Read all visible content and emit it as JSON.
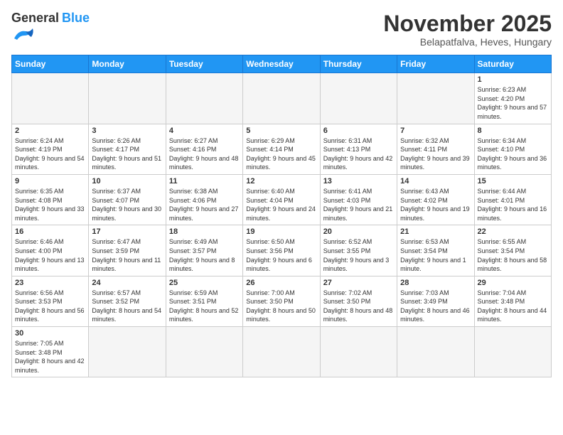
{
  "logo": {
    "general": "General",
    "blue": "Blue"
  },
  "header": {
    "title": "November 2025",
    "location": "Belapatfalva, Heves, Hungary"
  },
  "weekdays": [
    "Sunday",
    "Monday",
    "Tuesday",
    "Wednesday",
    "Thursday",
    "Friday",
    "Saturday"
  ],
  "weeks": [
    [
      {
        "day": "",
        "info": ""
      },
      {
        "day": "",
        "info": ""
      },
      {
        "day": "",
        "info": ""
      },
      {
        "day": "",
        "info": ""
      },
      {
        "day": "",
        "info": ""
      },
      {
        "day": "",
        "info": ""
      },
      {
        "day": "1",
        "info": "Sunrise: 6:23 AM\nSunset: 4:20 PM\nDaylight: 9 hours and 57 minutes."
      }
    ],
    [
      {
        "day": "2",
        "info": "Sunrise: 6:24 AM\nSunset: 4:19 PM\nDaylight: 9 hours and 54 minutes."
      },
      {
        "day": "3",
        "info": "Sunrise: 6:26 AM\nSunset: 4:17 PM\nDaylight: 9 hours and 51 minutes."
      },
      {
        "day": "4",
        "info": "Sunrise: 6:27 AM\nSunset: 4:16 PM\nDaylight: 9 hours and 48 minutes."
      },
      {
        "day": "5",
        "info": "Sunrise: 6:29 AM\nSunset: 4:14 PM\nDaylight: 9 hours and 45 minutes."
      },
      {
        "day": "6",
        "info": "Sunrise: 6:31 AM\nSunset: 4:13 PM\nDaylight: 9 hours and 42 minutes."
      },
      {
        "day": "7",
        "info": "Sunrise: 6:32 AM\nSunset: 4:11 PM\nDaylight: 9 hours and 39 minutes."
      },
      {
        "day": "8",
        "info": "Sunrise: 6:34 AM\nSunset: 4:10 PM\nDaylight: 9 hours and 36 minutes."
      }
    ],
    [
      {
        "day": "9",
        "info": "Sunrise: 6:35 AM\nSunset: 4:08 PM\nDaylight: 9 hours and 33 minutes."
      },
      {
        "day": "10",
        "info": "Sunrise: 6:37 AM\nSunset: 4:07 PM\nDaylight: 9 hours and 30 minutes."
      },
      {
        "day": "11",
        "info": "Sunrise: 6:38 AM\nSunset: 4:06 PM\nDaylight: 9 hours and 27 minutes."
      },
      {
        "day": "12",
        "info": "Sunrise: 6:40 AM\nSunset: 4:04 PM\nDaylight: 9 hours and 24 minutes."
      },
      {
        "day": "13",
        "info": "Sunrise: 6:41 AM\nSunset: 4:03 PM\nDaylight: 9 hours and 21 minutes."
      },
      {
        "day": "14",
        "info": "Sunrise: 6:43 AM\nSunset: 4:02 PM\nDaylight: 9 hours and 19 minutes."
      },
      {
        "day": "15",
        "info": "Sunrise: 6:44 AM\nSunset: 4:01 PM\nDaylight: 9 hours and 16 minutes."
      }
    ],
    [
      {
        "day": "16",
        "info": "Sunrise: 6:46 AM\nSunset: 4:00 PM\nDaylight: 9 hours and 13 minutes."
      },
      {
        "day": "17",
        "info": "Sunrise: 6:47 AM\nSunset: 3:59 PM\nDaylight: 9 hours and 11 minutes."
      },
      {
        "day": "18",
        "info": "Sunrise: 6:49 AM\nSunset: 3:57 PM\nDaylight: 9 hours and 8 minutes."
      },
      {
        "day": "19",
        "info": "Sunrise: 6:50 AM\nSunset: 3:56 PM\nDaylight: 9 hours and 6 minutes."
      },
      {
        "day": "20",
        "info": "Sunrise: 6:52 AM\nSunset: 3:55 PM\nDaylight: 9 hours and 3 minutes."
      },
      {
        "day": "21",
        "info": "Sunrise: 6:53 AM\nSunset: 3:54 PM\nDaylight: 9 hours and 1 minute."
      },
      {
        "day": "22",
        "info": "Sunrise: 6:55 AM\nSunset: 3:54 PM\nDaylight: 8 hours and 58 minutes."
      }
    ],
    [
      {
        "day": "23",
        "info": "Sunrise: 6:56 AM\nSunset: 3:53 PM\nDaylight: 8 hours and 56 minutes."
      },
      {
        "day": "24",
        "info": "Sunrise: 6:57 AM\nSunset: 3:52 PM\nDaylight: 8 hours and 54 minutes."
      },
      {
        "day": "25",
        "info": "Sunrise: 6:59 AM\nSunset: 3:51 PM\nDaylight: 8 hours and 52 minutes."
      },
      {
        "day": "26",
        "info": "Sunrise: 7:00 AM\nSunset: 3:50 PM\nDaylight: 8 hours and 50 minutes."
      },
      {
        "day": "27",
        "info": "Sunrise: 7:02 AM\nSunset: 3:50 PM\nDaylight: 8 hours and 48 minutes."
      },
      {
        "day": "28",
        "info": "Sunrise: 7:03 AM\nSunset: 3:49 PM\nDaylight: 8 hours and 46 minutes."
      },
      {
        "day": "29",
        "info": "Sunrise: 7:04 AM\nSunset: 3:48 PM\nDaylight: 8 hours and 44 minutes."
      }
    ],
    [
      {
        "day": "30",
        "info": "Sunrise: 7:05 AM\nSunset: 3:48 PM\nDaylight: 8 hours and 42 minutes."
      },
      {
        "day": "",
        "info": ""
      },
      {
        "day": "",
        "info": ""
      },
      {
        "day": "",
        "info": ""
      },
      {
        "day": "",
        "info": ""
      },
      {
        "day": "",
        "info": ""
      },
      {
        "day": "",
        "info": ""
      }
    ]
  ]
}
